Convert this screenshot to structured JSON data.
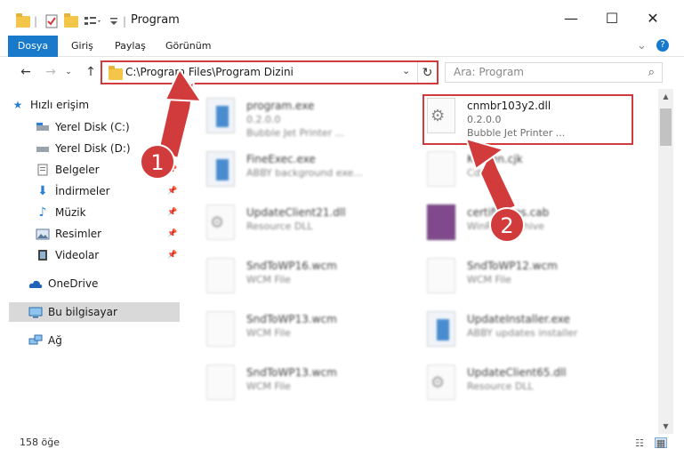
{
  "window": {
    "title": "Program",
    "separator": "|",
    "minimize": "—",
    "maximize": "☐",
    "close": "✕",
    "collapse": "⌄",
    "help": "?"
  },
  "ribbon": {
    "tabs": [
      "Dosya",
      "Giriş",
      "Paylaş",
      "Görünüm"
    ]
  },
  "address": {
    "path": "C:\\Program Files\\Program Dizini",
    "search_placeholder": "Ara: Program"
  },
  "nav": {
    "items": [
      {
        "label": "Hızlı erişim",
        "icon": "star-icon"
      },
      {
        "label": "Yerel Disk (C:)",
        "icon": "drive-icon"
      },
      {
        "label": "Yerel Disk (D:)",
        "icon": "drive-icon"
      },
      {
        "label": "Belgeler",
        "icon": "documents-icon"
      },
      {
        "label": "İndirmeler",
        "icon": "download-icon"
      },
      {
        "label": "Müzik",
        "icon": "music-icon"
      },
      {
        "label": "Resimler",
        "icon": "pictures-icon"
      },
      {
        "label": "Videolar",
        "icon": "video-icon"
      },
      {
        "label": "OneDrive",
        "icon": "cloud-icon"
      },
      {
        "label": "Bu bilgisayar",
        "icon": "computer-icon"
      },
      {
        "label": "Ağ",
        "icon": "network-icon"
      }
    ]
  },
  "files": [
    {
      "name": "program.exe",
      "line1": "0.2.0.0",
      "line2": "Bubble Jet Printer ...",
      "icon": "app"
    },
    {
      "name": "cnmbr103y2.dll",
      "line1": "0.2.0.0",
      "line2": "Bubble Jet Printer ...",
      "icon": "gear"
    },
    {
      "name": "FineExec.exe",
      "line1": "ABBY background exe...",
      "line2": "",
      "icon": "app"
    },
    {
      "name": "Kernen.cjk",
      "line1": "Cdfile",
      "line2": "",
      "icon": "doc"
    },
    {
      "name": "UpdateClient21.dll",
      "line1": "Resource DLL",
      "line2": "",
      "icon": "gear"
    },
    {
      "name": "certificates.cab",
      "line1": "WinRAR archive",
      "line2": "",
      "icon": "rar"
    },
    {
      "name": "SndToWP16.wcm",
      "line1": "WCM File",
      "line2": "",
      "icon": "doc"
    },
    {
      "name": "SndToWP12.wcm",
      "line1": "WCM File",
      "line2": "",
      "icon": "doc"
    },
    {
      "name": "SndToWP13.wcm",
      "line1": "WCM File",
      "line2": "",
      "icon": "doc"
    },
    {
      "name": "UpdateInstaller.exe",
      "line1": "ABBY updates installer",
      "line2": "",
      "icon": "app"
    },
    {
      "name": "SndToWP13.wcm",
      "line1": "WCM File",
      "line2": "",
      "icon": "doc"
    },
    {
      "name": "UpdateClient65.dll",
      "line1": "Resource DLL",
      "line2": "",
      "icon": "gear"
    }
  ],
  "status": {
    "count": "158 öğe"
  },
  "callouts": [
    "1",
    "2"
  ],
  "colors": {
    "accent": "#1979ca",
    "highlight": "#d23b3b"
  }
}
